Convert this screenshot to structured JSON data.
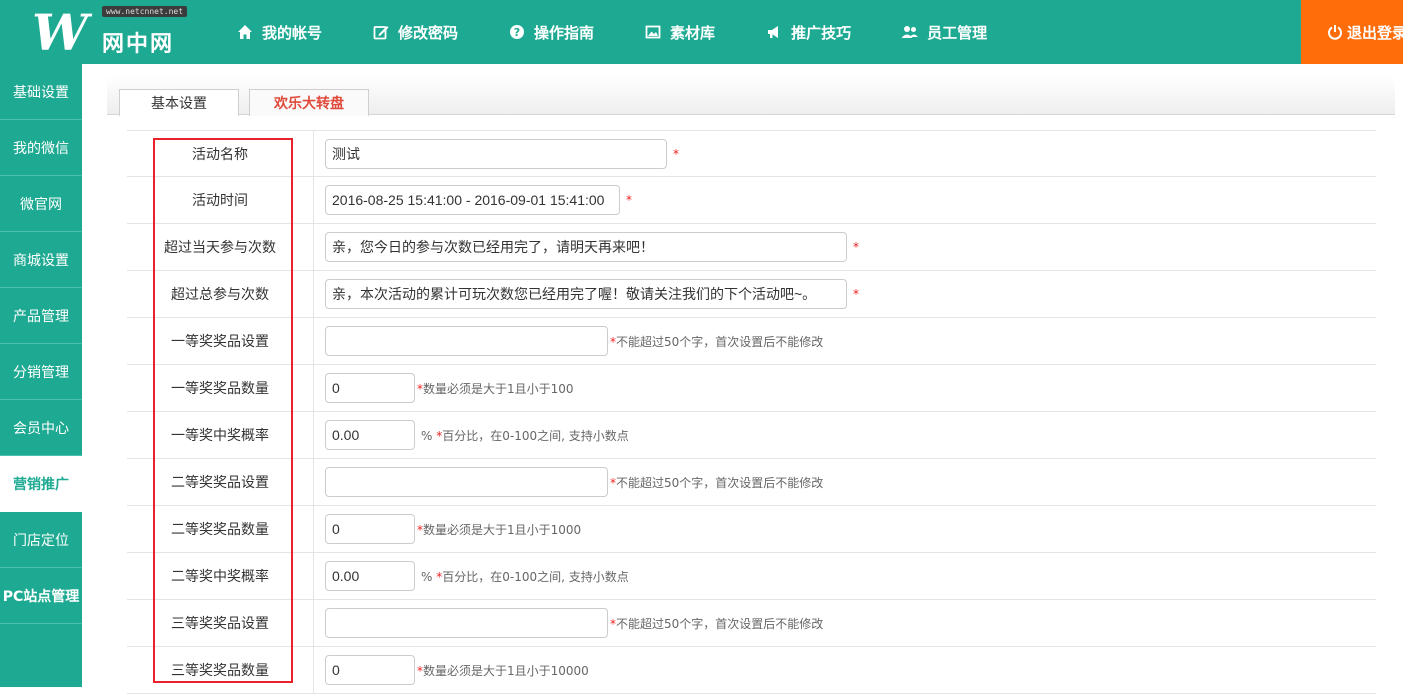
{
  "brand": {
    "url_badge": "www.netcnnet.net",
    "name": "网中网"
  },
  "nav": [
    {
      "label": "我的帐号",
      "icon": "home-icon"
    },
    {
      "label": "修改密码",
      "icon": "edit-icon"
    },
    {
      "label": "操作指南",
      "icon": "help-icon"
    },
    {
      "label": "素材库",
      "icon": "picture-icon"
    },
    {
      "label": "推广技巧",
      "icon": "megaphone-icon"
    },
    {
      "label": "员工管理",
      "icon": "users-icon"
    }
  ],
  "logout_label": "退出登录",
  "sidebar": [
    {
      "label": "基础设置"
    },
    {
      "label": "我的微信"
    },
    {
      "label": "微官网"
    },
    {
      "label": "商城设置"
    },
    {
      "label": "产品管理"
    },
    {
      "label": "分销管理"
    },
    {
      "label": "会员中心"
    },
    {
      "label": "营销推广",
      "active": true
    },
    {
      "label": "门店定位"
    },
    {
      "label": "PC站点管理"
    }
  ],
  "tabs": [
    {
      "label": "基本设置"
    },
    {
      "label": "欢乐大转盘",
      "active": true
    }
  ],
  "form": {
    "activity_name": {
      "label": "活动名称",
      "value": "测试",
      "required": "*"
    },
    "activity_time": {
      "label": "活动时间",
      "value": "2016-08-25 15:41:00 - 2016-09-01 15:41:00",
      "required": "*"
    },
    "daily_limit": {
      "label": "超过当天参与次数",
      "value": "亲，您今日的参与次数已经用完了，请明天再来吧！",
      "required": "*"
    },
    "total_limit": {
      "label": "超过总参与次数",
      "value": "亲，本次活动的累计可玩次数您已经用完了喔！敬请关注我们的下个活动吧~。",
      "required": "*"
    },
    "prize1_name": {
      "label": "一等奖奖品设置",
      "value": "",
      "star": "*",
      "hint": "不能超过50个字，首次设置后不能修改"
    },
    "prize1_count": {
      "label": "一等奖奖品数量",
      "value": "0",
      "star": "*",
      "hint": "数量必须是大于1且小于100"
    },
    "prize1_rate": {
      "label": "一等奖中奖概率",
      "value": "0.00",
      "unit": "%",
      "star": "*",
      "hint": "百分比，在0-100之间, 支持小数点"
    },
    "prize2_name": {
      "label": "二等奖奖品设置",
      "value": "",
      "star": "*",
      "hint": "不能超过50个字，首次设置后不能修改"
    },
    "prize2_count": {
      "label": "二等奖奖品数量",
      "value": "0",
      "star": "*",
      "hint": "数量必须是大于1且小于1000"
    },
    "prize2_rate": {
      "label": "二等奖中奖概率",
      "value": "0.00",
      "unit": "%",
      "star": "*",
      "hint": "百分比，在0-100之间, 支持小数点"
    },
    "prize3_name": {
      "label": "三等奖奖品设置",
      "value": "",
      "star": "*",
      "hint": "不能超过50个字，首次设置后不能修改"
    },
    "prize3_count": {
      "label": "三等奖奖品数量",
      "value": "0",
      "star": "*",
      "hint": "数量必须是大于1且小于10000"
    }
  },
  "colors": {
    "primary": "#1eaa92",
    "logout": "#ff6c0a",
    "highlight_box": "#e8212b",
    "active_tab_text": "#e04a3b"
  }
}
